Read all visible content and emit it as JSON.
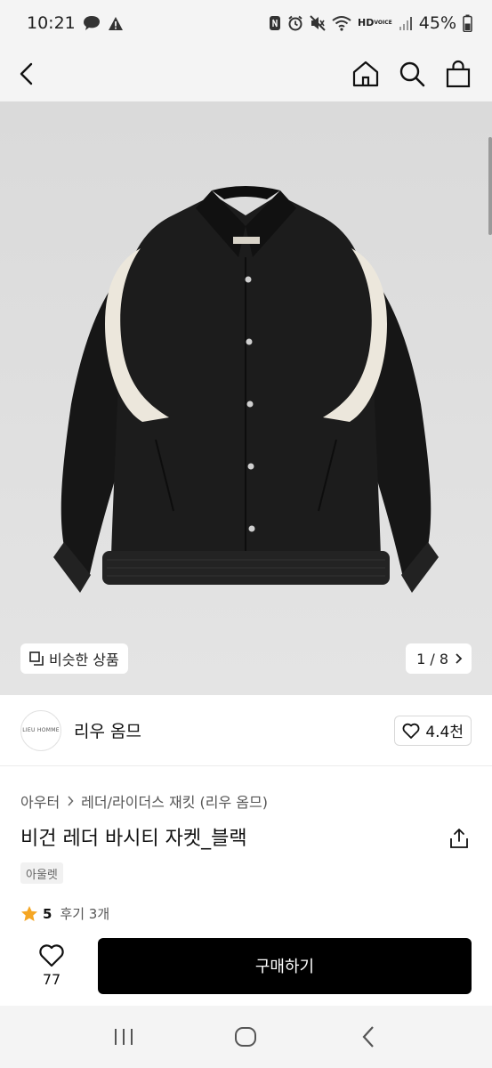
{
  "status_bar": {
    "time": "10:21",
    "battery": "45%",
    "hd_label": "HD",
    "voice_label": "VOICE",
    "icons": [
      "chat-icon",
      "warning-icon",
      "nfc-icon",
      "alarm-icon",
      "mute-icon",
      "wifi-icon",
      "signal-icon",
      "battery-icon"
    ]
  },
  "header": {
    "icons": [
      "back-icon",
      "home-icon",
      "search-icon",
      "bag-icon"
    ]
  },
  "image": {
    "similar_label": "비슷한 상품",
    "pager": "1 / 8",
    "jacket_colors": {
      "body": "#1c1c1c",
      "panel": "#ece7dc"
    },
    "logo_text": "LIEU HOMME"
  },
  "shop": {
    "logo_text": "LIEU HOMME",
    "name": "리우 옴므",
    "likes": "4.4천"
  },
  "product": {
    "category": "아우터",
    "subcategory": "레더/라이더스 재킷 (리우 옴므)",
    "title": "비건 레더 바시티 자켓_블랙",
    "tag": "아울렛",
    "rating": "5",
    "reviews": "후기 3개"
  },
  "bottom": {
    "wish_count": "77",
    "buy_label": "구매하기"
  },
  "colors": {
    "accent": "#000000",
    "star": "#f5a623"
  }
}
